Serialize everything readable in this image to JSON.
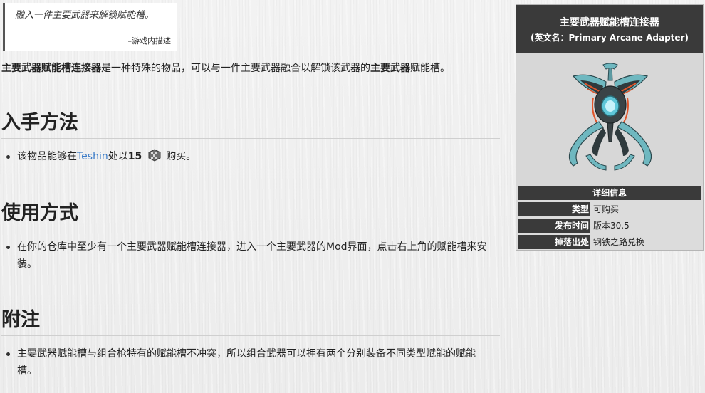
{
  "quote": {
    "text": "融入一件主要武器来解锁赋能槽。",
    "source": "–游戏内描述"
  },
  "intro": {
    "bold_name": "主要武器赋能槽连接器",
    "text_1": "是一种特殊的物品，可以与一件主要武器融合以解锁该武器的",
    "bold_slot": "主要武器",
    "text_2": "赋能槽。"
  },
  "sections": {
    "acquisition": {
      "heading": "入手方法",
      "item_prefix": "该物品能够在",
      "vendor_link": "Teshin",
      "item_mid": "处以",
      "price": "15",
      "currency_icon": "steel-essence-icon",
      "item_suffix": "购买。"
    },
    "usage": {
      "heading": "使用方式",
      "item": "在你的仓库中至少有一个主要武器赋能槽连接器，进入一个主要武器的Mod界面，点击右上角的赋能槽来安装。"
    },
    "notes": {
      "heading": "附注",
      "item": "主要武器赋能槽与组合枪特有的赋能槽不冲突，所以组合武器可以拥有两个分别装备不同类型赋能的赋能槽。"
    }
  },
  "infobox": {
    "title": "主要武器赋能槽连接器",
    "subtitle": "(英文名：Primary Arcane Adapter)",
    "section_label": "详细信息",
    "rows": [
      {
        "key": "类型",
        "value": "可购买",
        "is_link": false
      },
      {
        "key": "发布时间",
        "value": "版本30.5",
        "is_link": true
      },
      {
        "key": "掉落出处",
        "value": "钢铁之路兑换",
        "is_link": true
      }
    ]
  },
  "colors": {
    "link": "#3a7bc8",
    "header_bg": "#3a3a3a",
    "page_bg": "#efefef",
    "adapter_teal": "#6fb8c0",
    "adapter_orange": "#e0552a"
  }
}
